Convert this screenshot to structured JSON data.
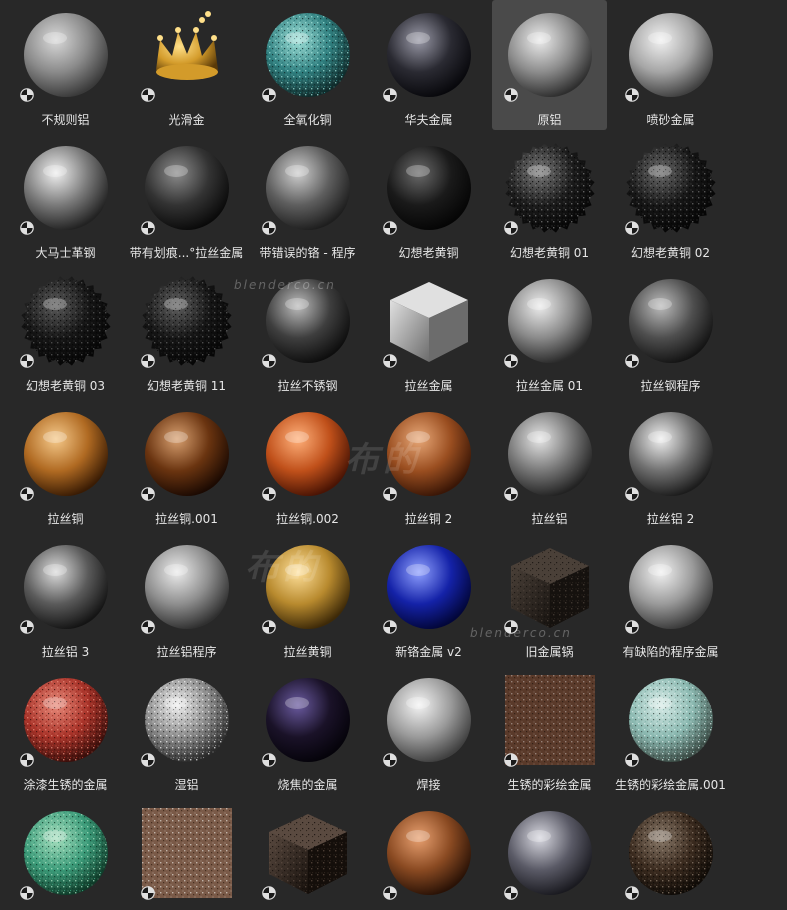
{
  "browser": {
    "items": [
      {
        "label": "不规则铝",
        "kind": "sphere",
        "c1": "#d9d9d9",
        "c2": "#8a8a8a",
        "c3": "#3a3a3a",
        "noise": false,
        "selected": false
      },
      {
        "label": "光滑金",
        "kind": "crown",
        "c1": "#ffe08a",
        "c2": "#d39b2a",
        "c3": "#5a3a08",
        "noise": false,
        "selected": false
      },
      {
        "label": "全氧化铜",
        "kind": "sphere",
        "c1": "#9fe0d8",
        "c2": "#2f7f7f",
        "c3": "#0f2a2a",
        "noise": true,
        "selected": false
      },
      {
        "label": "华夫金属",
        "kind": "sphere",
        "c1": "#9a9aa8",
        "c2": "#2a2a32",
        "c3": "#08080c",
        "noise": false,
        "selected": false
      },
      {
        "label": "原铝",
        "kind": "sphere",
        "c1": "#ececec",
        "c2": "#8c8c8c",
        "c3": "#2e2e2e",
        "noise": false,
        "selected": true
      },
      {
        "label": "喷砂金属",
        "kind": "sphere",
        "c1": "#f2f2f2",
        "c2": "#a5a5a5",
        "c3": "#404040",
        "noise": false,
        "selected": false
      },
      {
        "label": "大马士革钢",
        "kind": "sphere",
        "c1": "#f0f0f0",
        "c2": "#7a7a7a",
        "c3": "#222222",
        "noise": false,
        "selected": false
      },
      {
        "label": "带有划痕...°拉丝金属",
        "kind": "sphere",
        "c1": "#8c8c8c",
        "c2": "#333333",
        "c3": "#0a0a0a",
        "noise": false,
        "selected": false
      },
      {
        "label": "带错误的铬 - 程序",
        "kind": "sphere",
        "c1": "#cfcfcf",
        "c2": "#5e5e5e",
        "c3": "#1e1e1e",
        "noise": false,
        "selected": false
      },
      {
        "label": "幻想老黄铜",
        "kind": "sphere",
        "c1": "#6a6a6a",
        "c2": "#1a1a1a",
        "c3": "#050505",
        "noise": false,
        "selected": false
      },
      {
        "label": "幻想老黄铜 01",
        "kind": "spiky",
        "c1": "#7a7a7a",
        "c2": "#1a1a1a",
        "c3": "#050505",
        "noise": true,
        "selected": false
      },
      {
        "label": "幻想老黄铜 02",
        "kind": "spiky",
        "c1": "#6a6a6a",
        "c2": "#151515",
        "c3": "#050505",
        "noise": true,
        "selected": false
      },
      {
        "label": "幻想老黄铜 03",
        "kind": "spiky",
        "c1": "#5a5a5a",
        "c2": "#141414",
        "c3": "#050505",
        "noise": true,
        "selected": false
      },
      {
        "label": "幻想老黄铜 11",
        "kind": "spiky",
        "c1": "#606060",
        "c2": "#141414",
        "c3": "#050505",
        "noise": true,
        "selected": false
      },
      {
        "label": "拉丝不锈钢",
        "kind": "sphere",
        "c1": "#bdbdbd",
        "c2": "#3e3e3e",
        "c3": "#0e0e0e",
        "noise": false,
        "selected": false
      },
      {
        "label": "拉丝金属",
        "kind": "cube",
        "c1": "#e0e0e0",
        "c2": "#a6a6a6",
        "c3": "#6c6c6c",
        "noise": false,
        "selected": false
      },
      {
        "label": "拉丝金属 01",
        "kind": "sphere",
        "c1": "#ededed",
        "c2": "#8a8a8a",
        "c3": "#2a2a2a",
        "noise": false,
        "selected": false
      },
      {
        "label": "拉丝钢程序",
        "kind": "sphere",
        "c1": "#bcbcbc",
        "c2": "#4e4e4e",
        "c3": "#141414",
        "noise": false,
        "selected": false
      },
      {
        "label": "拉丝铜",
        "kind": "sphere",
        "c1": "#f5c98a",
        "c2": "#b06a22",
        "c3": "#3a1c04",
        "noise": false,
        "selected": false
      },
      {
        "label": "拉丝铜.001",
        "kind": "sphere",
        "c1": "#d8a070",
        "c2": "#6a3410",
        "c3": "#1c0a02",
        "noise": false,
        "selected": false
      },
      {
        "label": "拉丝铜.002",
        "kind": "sphere",
        "c1": "#ffb07a",
        "c2": "#c0501a",
        "c3": "#4a1404",
        "noise": false,
        "selected": false
      },
      {
        "label": "拉丝铜 2",
        "kind": "sphere",
        "c1": "#e8a878",
        "c2": "#9a4e20",
        "c3": "#3a1606",
        "noise": false,
        "selected": false
      },
      {
        "label": "拉丝铝",
        "kind": "sphere",
        "c1": "#e6e6e6",
        "c2": "#787878",
        "c3": "#222222",
        "noise": false,
        "selected": false
      },
      {
        "label": "拉丝铝 2",
        "kind": "sphere",
        "c1": "#f0f0f0",
        "c2": "#707070",
        "c3": "#1c1c1c",
        "noise": false,
        "selected": false
      },
      {
        "label": "拉丝铝 3",
        "kind": "sphere",
        "c1": "#dcdcdc",
        "c2": "#5a5a5a",
        "c3": "#141414",
        "noise": false,
        "selected": false
      },
      {
        "label": "拉丝铝程序",
        "kind": "sphere",
        "c1": "#ececec",
        "c2": "#8e8e8e",
        "c3": "#303030",
        "noise": false,
        "selected": false
      },
      {
        "label": "拉丝黄铜",
        "kind": "sphere",
        "c1": "#ffe09a",
        "c2": "#b88a2e",
        "c3": "#3e2a08",
        "noise": false,
        "selected": false
      },
      {
        "label": "新铬金属 v2",
        "kind": "sphere",
        "c1": "#8fa0ff",
        "c2": "#1422a8",
        "c3": "#02063a",
        "noise": false,
        "selected": false
      },
      {
        "label": "旧金属锅",
        "kind": "cube",
        "c1": "#4a4038",
        "c2": "#2a241e",
        "c3": "#15110e",
        "noise": true,
        "selected": false
      },
      {
        "label": "有缺陷的程序金属",
        "kind": "sphere",
        "c1": "#f2f2f2",
        "c2": "#9a9a9a",
        "c3": "#3a3a3a",
        "noise": false,
        "selected": false
      },
      {
        "label": "涂漆生锈的金属",
        "kind": "sphere",
        "c1": "#e88a7a",
        "c2": "#a83228",
        "c3": "#3a0e0a",
        "noise": true,
        "selected": false
      },
      {
        "label": "湿铝",
        "kind": "sphere",
        "c1": "#f0f0f0",
        "c2": "#8a8a8a",
        "c3": "#2a2a2a",
        "noise": true,
        "selected": false
      },
      {
        "label": "烧焦的金属",
        "kind": "sphere",
        "c1": "#6a5aa0",
        "c2": "#1a1228",
        "c3": "#05030a",
        "noise": false,
        "selected": false
      },
      {
        "label": "焊接",
        "kind": "sphere",
        "c1": "#f4f4f4",
        "c2": "#9a9a9a",
        "c3": "#404040",
        "noise": false,
        "selected": false
      },
      {
        "label": "生锈的彩绘金属",
        "kind": "square",
        "c1": "#a89890",
        "c2": "#5a3a2a",
        "c3": "#2a1a12",
        "noise": true,
        "selected": false
      },
      {
        "label": "生锈的彩绘金属.001",
        "kind": "sphere",
        "c1": "#d8ece8",
        "c2": "#8ab8b0",
        "c3": "#3a4a44",
        "noise": true,
        "selected": false
      },
      {
        "label": "",
        "kind": "sphere",
        "c1": "#a8e0c0",
        "c2": "#3a9a78",
        "c3": "#0e3a28",
        "noise": true,
        "selected": false
      },
      {
        "label": "",
        "kind": "square",
        "c1": "#d8d0c8",
        "c2": "#7a5a48",
        "c3": "#3a2418",
        "noise": true,
        "selected": false
      },
      {
        "label": "",
        "kind": "cube",
        "c1": "#5a4a40",
        "c2": "#2e241c",
        "c3": "#140e0a",
        "noise": true,
        "selected": false
      },
      {
        "label": "",
        "kind": "sphere",
        "c1": "#e8a070",
        "c2": "#8a4a22",
        "c3": "#2a1206",
        "noise": false,
        "selected": false
      },
      {
        "label": "",
        "kind": "sphere",
        "c1": "#d8d8e0",
        "c2": "#5a5a66",
        "c3": "#1a1a20",
        "noise": false,
        "selected": false
      },
      {
        "label": "",
        "kind": "sphere",
        "c1": "#8a7a6a",
        "c2": "#3a2a1e",
        "c3": "#0e0a06",
        "noise": true,
        "selected": false
      }
    ]
  },
  "watermarks": {
    "site": "blenderco.cn",
    "brand": "布的"
  },
  "colors": {
    "background": "#282828",
    "selected_tile": "#4a4a4a",
    "label_text": "#e6e6e6"
  }
}
